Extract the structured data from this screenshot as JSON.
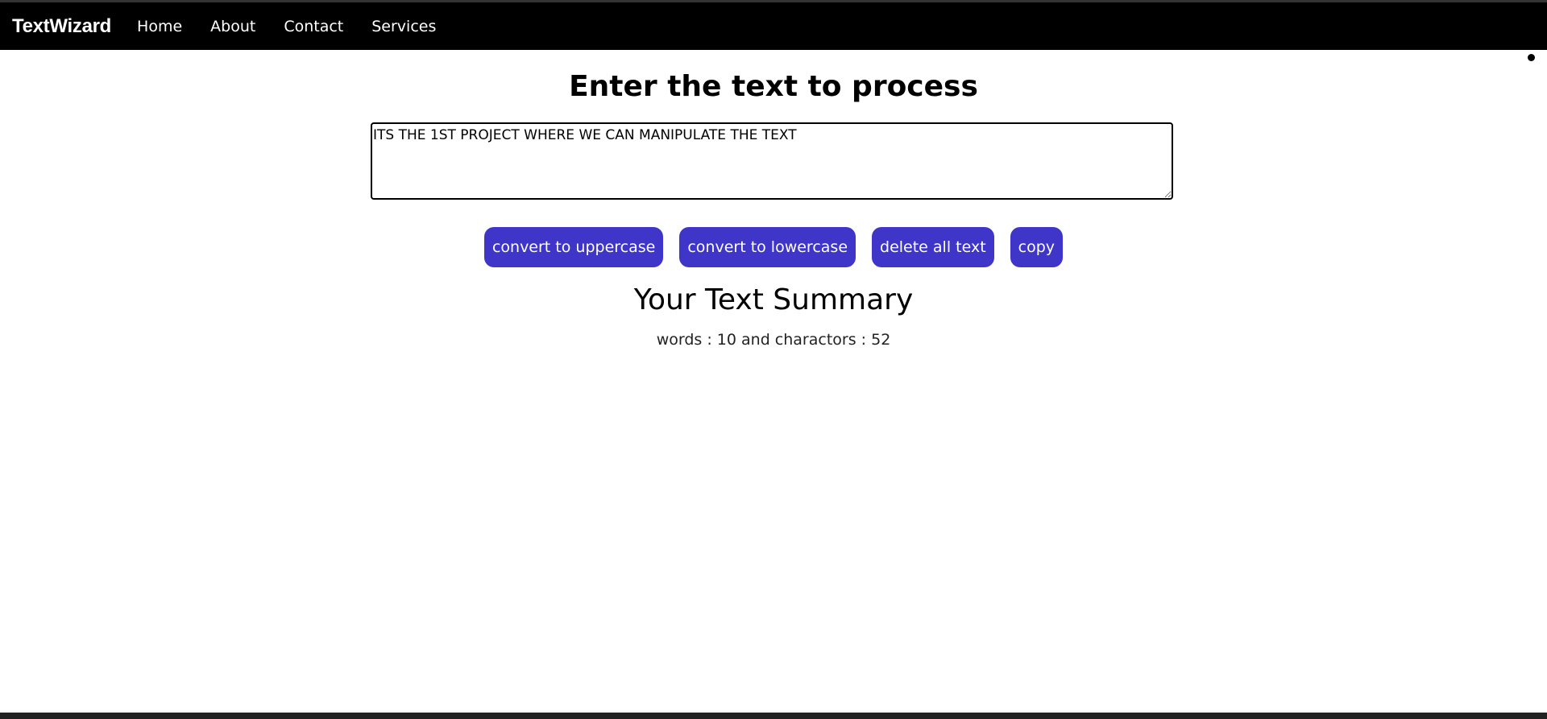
{
  "navbar": {
    "brand": "TextWizard",
    "links": [
      "Home",
      "About",
      "Contact",
      "Services"
    ],
    "background": "#000000"
  },
  "main": {
    "title": "Enter the text to process",
    "textarea_value": "ITS THE 1ST PROJECT WHERE WE CAN MANIPULATE THE TEXT",
    "buttons": [
      "convert to uppercase",
      "convert to lowercase",
      "delete all text",
      "copy"
    ],
    "button_color": "#3f35c9",
    "summary_title": "Your Text Summary",
    "summary_text": "words : 10 and charactors : 52"
  }
}
